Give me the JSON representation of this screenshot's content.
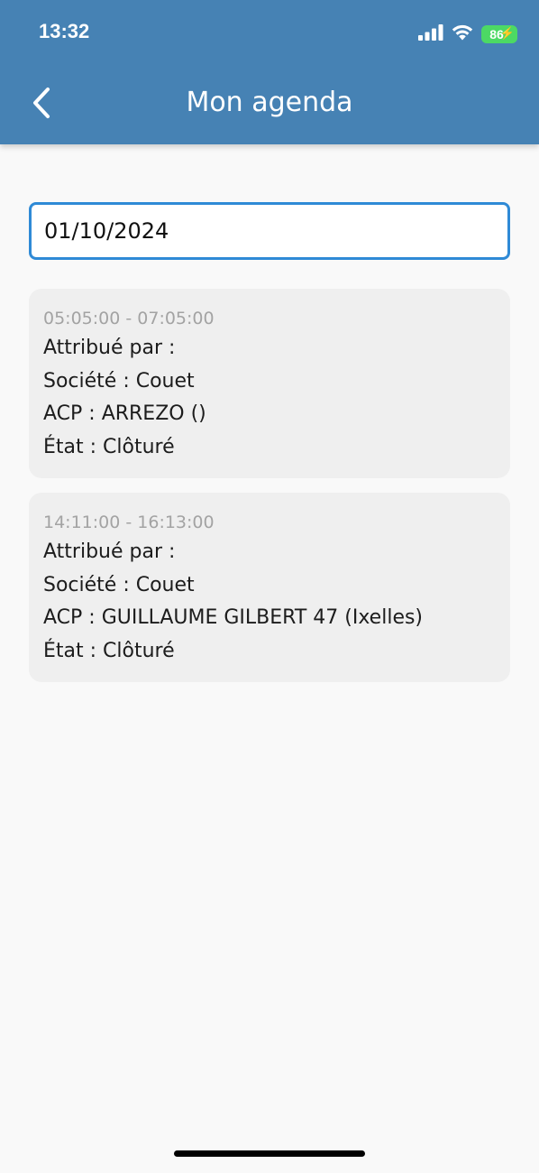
{
  "status_bar": {
    "time": "13:32",
    "battery": "86"
  },
  "header": {
    "title": "Mon agenda",
    "back_icon": "chevron-left-icon"
  },
  "date_field": {
    "value": "01/10/2024"
  },
  "appointments": [
    {
      "time": "05:05:00 - 07:05:00",
      "assigned_by": "Attribué par :",
      "company": "Société : Couet",
      "acp": "ACP : ARREZO ()",
      "state": "État : Clôturé"
    },
    {
      "time": "14:11:00 - 16:13:00",
      "assigned_by": "Attribué par :",
      "company": "Société : Couet",
      "acp": "ACP : GUILLAUME GILBERT 47 (Ixelles)",
      "state": "État : Clôturé"
    }
  ],
  "colors": {
    "header": "#4682b4",
    "input_border": "#2f8ad6",
    "card_bg": "#efefef",
    "time_text": "#a3a3a3",
    "battery": "#4cd964"
  }
}
